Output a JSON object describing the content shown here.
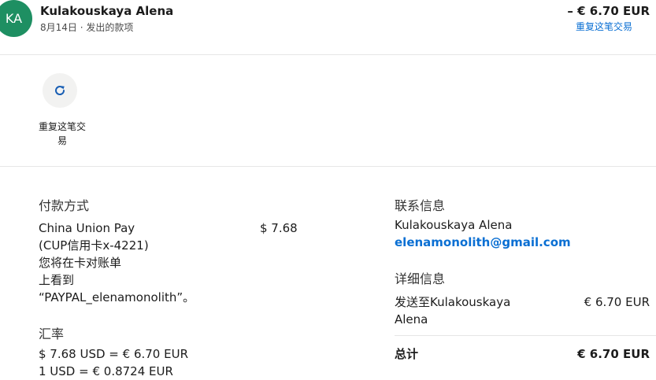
{
  "header": {
    "avatar_initials": "KA",
    "name": "Kulakouskaya Alena",
    "subtitle": "8月14日 · 发出的款项",
    "amount": "– € 6.70 EUR",
    "repeat_link": "重复这笔交易"
  },
  "actions": {
    "repeat_button_label": "重复这笔交易",
    "repeat_icon": "refresh-icon"
  },
  "payment": {
    "heading": "付款方式",
    "method_lines": [
      "China Union Pay",
      "(CUP信用卡x-4221)",
      "您将在卡对账单",
      "上看到",
      "“PAYPAL_elenamonolith”。"
    ],
    "amount": "$ 7.68"
  },
  "exchange": {
    "heading": "汇率",
    "line1": "$ 7.68 USD = € 6.70 EUR",
    "line2": "1 USD = € 0.8724 EUR"
  },
  "contact": {
    "heading": "联系信息",
    "name": "Kulakouskaya Alena",
    "email": "elenamonolith@gmail.com"
  },
  "details": {
    "heading": "详细信息",
    "sent_to_line1": "发送至Kulakouskaya",
    "sent_to_line2": "Alena",
    "sent_amount": "€ 6.70 EUR",
    "total_label": "总计",
    "total_amount": "€ 6.70 EUR"
  },
  "colors": {
    "avatar": "#1e8f62",
    "link": "#0a6fd3",
    "button_bg": "#f2f2f1"
  }
}
